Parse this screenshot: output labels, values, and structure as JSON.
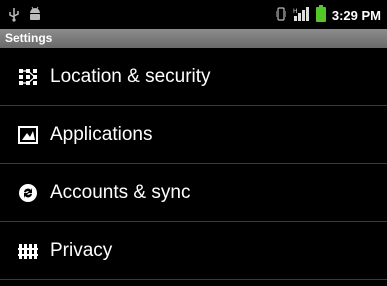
{
  "status_bar": {
    "time": "3:29 PM",
    "icons": [
      "usb-icon",
      "android-debug-icon",
      "vibrate-icon",
      "hspa-signal-icon",
      "battery-icon"
    ]
  },
  "title_bar": {
    "title": "Settings"
  },
  "settings_list": {
    "items": [
      {
        "label": "Location & security",
        "icon": "location-security-icon"
      },
      {
        "label": "Applications",
        "icon": "applications-icon"
      },
      {
        "label": "Accounts & sync",
        "icon": "accounts-sync-icon"
      },
      {
        "label": "Privacy",
        "icon": "privacy-icon"
      }
    ]
  },
  "colors": {
    "background": "#000000",
    "title_bar": "#7a7a7a",
    "battery": "#53c62a",
    "divider": "#3a3a3a"
  }
}
